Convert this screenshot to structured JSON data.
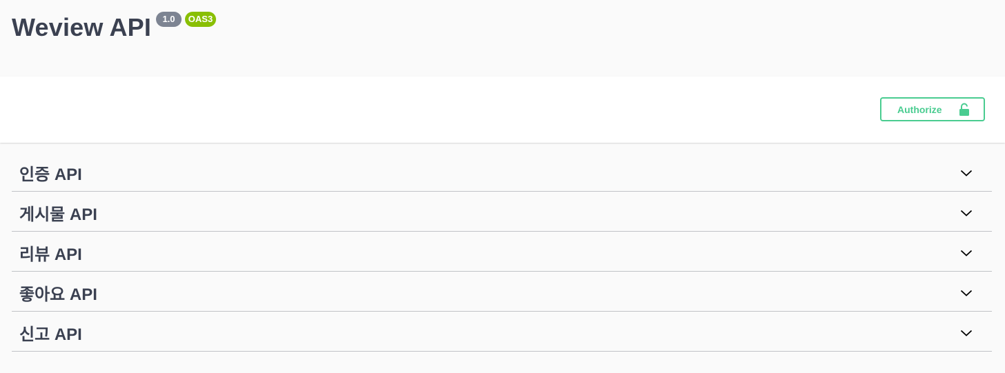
{
  "info": {
    "title": "Weview API",
    "version_badge": "1.0",
    "oas_badge": "OAS3"
  },
  "scheme": {
    "authorize_label": "Authorize",
    "authorize_icon": "unlocked-lock-icon"
  },
  "colors": {
    "accent_green": "#49cc90",
    "oas_badge": "#89bf04",
    "version_badge": "#7d8492",
    "text": "#3b4151"
  },
  "tags": [
    {
      "name": "인증 API",
      "icon": "chevron-down-icon"
    },
    {
      "name": "게시물 API",
      "icon": "chevron-down-icon"
    },
    {
      "name": "리뷰 API",
      "icon": "chevron-down-icon"
    },
    {
      "name": "좋아요 API",
      "icon": "chevron-down-icon"
    },
    {
      "name": "신고 API",
      "icon": "chevron-down-icon"
    }
  ]
}
